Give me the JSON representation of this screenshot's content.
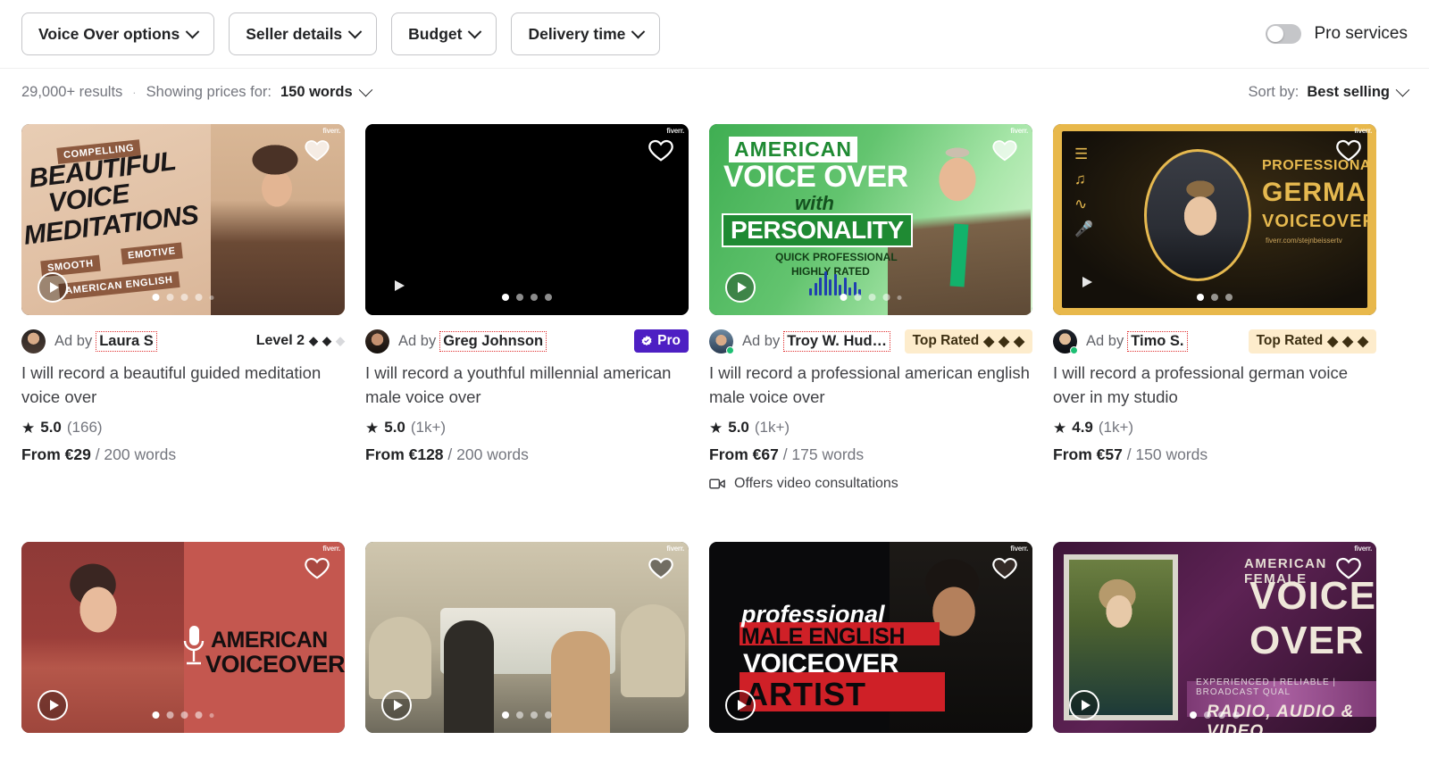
{
  "filter_bar": {
    "filters": [
      {
        "label": "Voice Over options",
        "icon": "chevron-down-icon"
      },
      {
        "label": "Seller details",
        "icon": "chevron-down-icon"
      },
      {
        "label": "Budget",
        "icon": "chevron-down-icon"
      },
      {
        "label": "Delivery time",
        "icon": "chevron-down-icon"
      }
    ],
    "pro_toggle": {
      "label": "Pro services",
      "enabled": false
    }
  },
  "results_bar": {
    "count": "29,000+ results",
    "separator": "·",
    "showing_prices_label": "Showing prices for:",
    "words_value": "150 words",
    "sort_label": "Sort by:",
    "sort_value": "Best selling"
  },
  "accent_colors": {
    "pro_badge_bg": "#4d1fc3",
    "top_rated_bg": "#fdeccc",
    "online_dot": "#1dbf73",
    "link_outline": "#e03131"
  },
  "cards": [
    {
      "ad_by": "Ad by",
      "seller": "Laura S",
      "badge_type": "level",
      "badge_label": "Level 2",
      "diamonds_filled": 2,
      "diamonds_total": 3,
      "online": false,
      "title": "I will record a beautiful guided meditation voice over",
      "rating": "5.0",
      "reviews": "(166)",
      "price_from": "From €29",
      "price_unit": "/ 200 words",
      "video_consultations": null,
      "thumb": {
        "style": "meditation",
        "texts": [
          "COMPELLING",
          "BEAUTIFUL",
          "VOICE",
          "MEDITATIONS",
          "SMOOTH",
          "EMOTIVE",
          "AMERICAN ENGLISH"
        ],
        "dots": 5,
        "active_dot": 1,
        "play": "play-icon",
        "watermark": "fiverr."
      }
    },
    {
      "ad_by": "Ad by",
      "seller": "Greg Johnson",
      "badge_type": "pro",
      "badge_label": "Pro",
      "diamonds_filled": 0,
      "diamonds_total": 0,
      "online": false,
      "title": "I will record a youthful millennial american male voice over",
      "rating": "5.0",
      "reviews": "(1k+)",
      "price_from": "From €128",
      "price_unit": "/ 200 words",
      "video_consultations": null,
      "thumb": {
        "style": "dark-video",
        "texts": [],
        "dots": 4,
        "active_dot": 1,
        "play": "play-icon",
        "watermark": "fiverr."
      }
    },
    {
      "ad_by": "Ad by",
      "seller": "Troy W. Hud…",
      "badge_type": "top_rated",
      "badge_label": "Top Rated",
      "diamonds_filled": 3,
      "diamonds_total": 3,
      "online": true,
      "title": "I will record a professional american english male voice over",
      "rating": "5.0",
      "reviews": "(1k+)",
      "price_from": "From €67",
      "price_unit": "/ 175 words",
      "video_consultations": "Offers video consultations",
      "thumb": {
        "style": "green-personality",
        "texts": [
          "AMERICAN",
          "VOICE OVER",
          "with",
          "PERSONALITY",
          "QUICK",
          "PROFESSIONAL",
          "HIGHLY RATED"
        ],
        "dots": 5,
        "active_dot": 1,
        "play": "play-icon",
        "watermark": "fiverr."
      }
    },
    {
      "ad_by": "Ad by",
      "seller": "Timo S.",
      "badge_type": "top_rated",
      "badge_label": "Top Rated",
      "diamonds_filled": 3,
      "diamonds_total": 3,
      "online": true,
      "title": "I will record a professional german voice over in my studio",
      "rating": "4.9",
      "reviews": "(1k+)",
      "price_from": "From €57",
      "price_unit": "/ 150 words",
      "video_consultations": null,
      "thumb": {
        "style": "gold-german",
        "texts": [
          "PROFESSIONAL",
          "GERMAN",
          "VOICEOVER",
          "fiverr.com/stejnbeissertv"
        ],
        "dots": 3,
        "active_dot": 1,
        "play": "play-icon",
        "watermark": "fiverr."
      }
    }
  ],
  "cards_row2": [
    {
      "thumb": {
        "style": "red-american",
        "texts": [
          "AMERICAN",
          "VOICEOVER"
        ],
        "dots": 5,
        "active_dot": 1,
        "play": "play-icon",
        "watermark": "fiverr."
      }
    },
    {
      "thumb": {
        "style": "car-video",
        "texts": [],
        "dots": 4,
        "active_dot": 1,
        "play": "play-icon",
        "watermark": "fiverr."
      }
    },
    {
      "thumb": {
        "style": "black-red-artist",
        "texts": [
          "professional",
          "MALE ENGLISH",
          "VOICEOVER",
          "ARTIST"
        ],
        "dots": 0,
        "active_dot": 0,
        "play": "play-icon",
        "watermark": "fiverr."
      }
    },
    {
      "thumb": {
        "style": "purple-female",
        "texts": [
          "AMERICAN FEMALE",
          "VOICE",
          "OVER",
          "EXPERIENCED  |  RELIABLE  |  BROADCAST QUAL",
          "RADIO, AUDIO & VIDEO"
        ],
        "dots": 4,
        "active_dot": 1,
        "play": "play-icon",
        "watermark": "fiverr."
      }
    }
  ]
}
